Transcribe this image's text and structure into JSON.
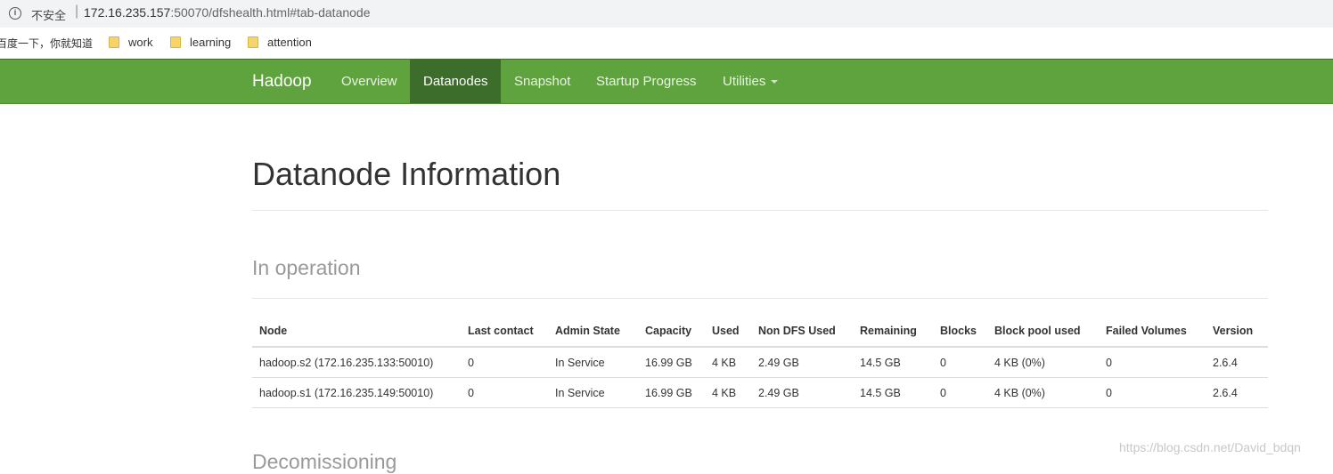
{
  "browser": {
    "security_label": "不安全",
    "separator": "|",
    "url_host": "172.16.235.157",
    "url_rest": ":50070/dfshealth.html#tab-datanode",
    "bookmarks": {
      "cut_text": "百度一下，你就知道",
      "items": [
        "work",
        "learning",
        "attention"
      ]
    }
  },
  "navbar": {
    "brand": "Hadoop",
    "items": [
      "Overview",
      "Datanodes",
      "Snapshot",
      "Startup Progress",
      "Utilities"
    ],
    "active": "Datanodes",
    "colors": {
      "bar": "#5fa33e",
      "active": "#3d6d2a"
    }
  },
  "page": {
    "title": "Datanode Information",
    "section_in_operation": "In operation",
    "section_decommissioning": "Decomissioning"
  },
  "table": {
    "headers": [
      "Node",
      "Last contact",
      "Admin State",
      "Capacity",
      "Used",
      "Non DFS Used",
      "Remaining",
      "Blocks",
      "Block pool used",
      "Failed Volumes",
      "Version"
    ],
    "rows": [
      [
        "hadoop.s2 (172.16.235.133:50010)",
        "0",
        "In Service",
        "16.99 GB",
        "4 KB",
        "2.49 GB",
        "14.5 GB",
        "0",
        "4 KB (0%)",
        "0",
        "2.6.4"
      ],
      [
        "hadoop.s1 (172.16.235.149:50010)",
        "0",
        "In Service",
        "16.99 GB",
        "4 KB",
        "2.49 GB",
        "14.5 GB",
        "0",
        "4 KB (0%)",
        "0",
        "2.6.4"
      ]
    ]
  },
  "watermark": "https://blog.csdn.net/David_bdqn"
}
